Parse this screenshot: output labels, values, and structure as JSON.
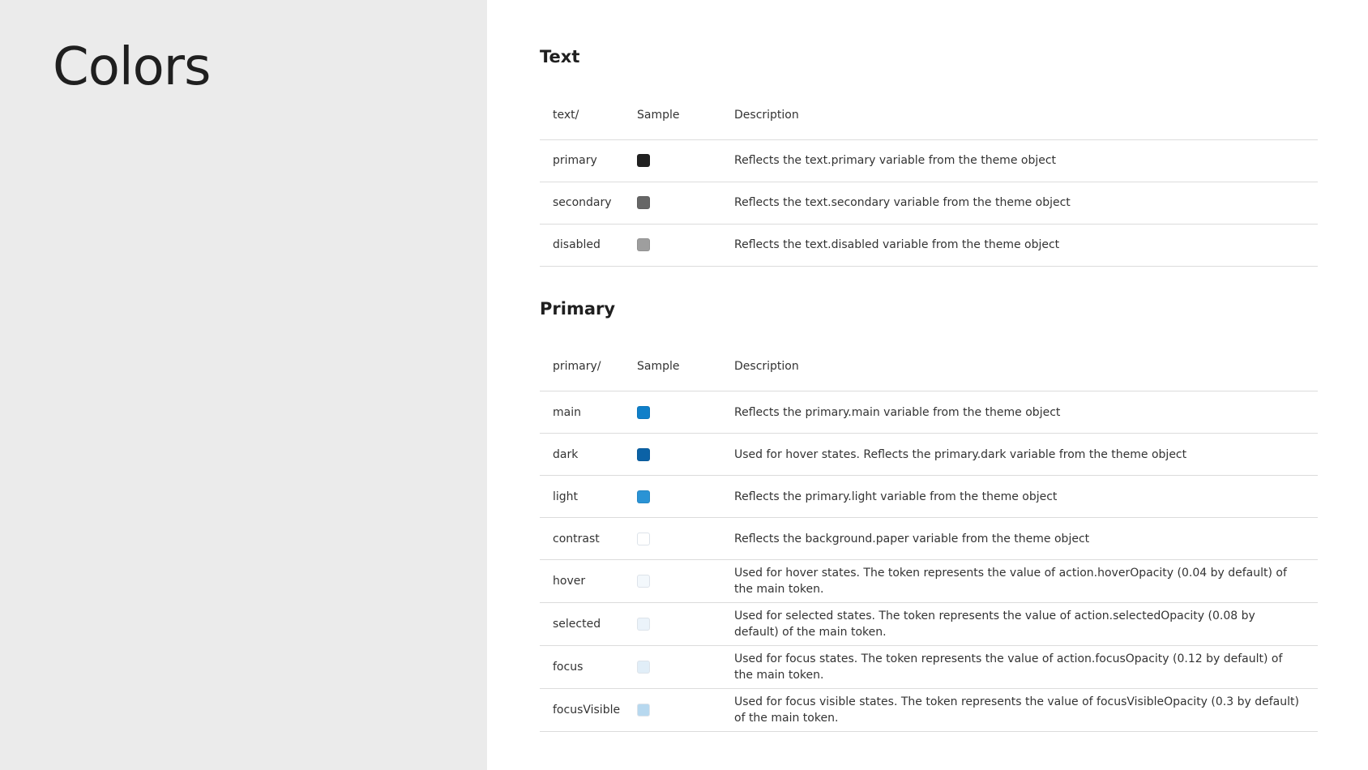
{
  "page": {
    "title": "Colors"
  },
  "sections": {
    "text": {
      "title": "Text",
      "headers": {
        "name": "text/",
        "sample": "Sample",
        "description": "Description"
      },
      "rows": [
        {
          "name": "primary",
          "color": "#212121",
          "description": "Reflects the text.primary variable from the theme object"
        },
        {
          "name": "secondary",
          "color": "#666666",
          "description": "Reflects the text.secondary variable from the theme object"
        },
        {
          "name": "disabled",
          "color": "#9e9e9e",
          "description": "Reflects the text.disabled variable from the theme object"
        }
      ]
    },
    "primary": {
      "title": "Primary",
      "headers": {
        "name": "primary/",
        "sample": "Sample",
        "description": "Description"
      },
      "rows": [
        {
          "name": "main",
          "color": "#0f7fc9",
          "description": "Reflects the primary.main variable from the theme object"
        },
        {
          "name": "dark",
          "color": "#0b62a6",
          "description": "Used for hover states. Reflects the primary.dark variable from the theme object"
        },
        {
          "name": "light",
          "color": "#2a93d5",
          "description": "Reflects the primary.light variable from the theme object"
        },
        {
          "name": "contrast",
          "color": "#ffffff",
          "description": "Reflects the background.paper variable from the theme object"
        },
        {
          "name": "hover",
          "color": "#f3f8fc",
          "description": "Used for hover states. The token represents the value of action.hoverOpacity (0.04 by default) of the main token."
        },
        {
          "name": "selected",
          "color": "#ebf3fa",
          "description": "Used for selected states. The token represents the value of action.selectedOpacity (0.08 by default) of the main token."
        },
        {
          "name": "focus",
          "color": "#e1eef8",
          "description": "Used for focus states. The token represents the value of action.focusOpacity (0.12 by default) of the main token."
        },
        {
          "name": "focusVisible",
          "color": "#b7d8ef",
          "description": "Used for focus visible states. The token represents the value of focusVisibleOpacity (0.3 by default) of the main token."
        }
      ]
    }
  }
}
